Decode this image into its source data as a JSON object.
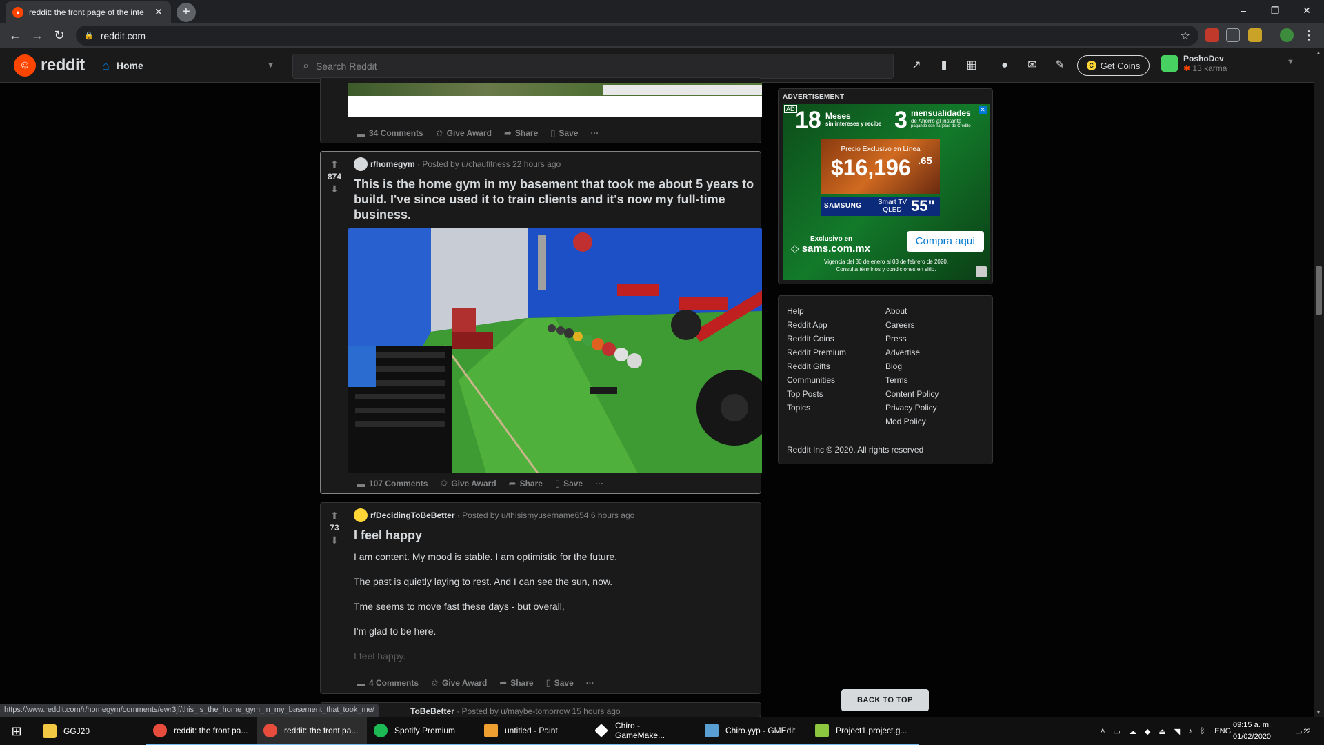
{
  "browser": {
    "tab_title": "reddit: the front page of the inte",
    "new_tab": "+",
    "url": "reddit.com",
    "controls": {
      "minimize": "–",
      "maximize": "❐",
      "close": "✕"
    }
  },
  "header": {
    "logo_text": "reddit",
    "home_label": "Home",
    "search_placeholder": "Search Reddit",
    "get_coins": "Get Coins",
    "username": "PoshoDev",
    "karma": "13 karma"
  },
  "posts": [
    {
      "comments": "34 Comments",
      "give_award": "Give Award",
      "share": "Share",
      "save": "Save",
      "more": "···"
    },
    {
      "votes": "874",
      "subreddit": "r/homegym",
      "posted_by": "· Posted by u/chaufitness 22 hours ago",
      "title": "This is the home gym in my basement that took me about 5 years to build. I've since used it to train clients and it's now my full-time business.",
      "comments": "107 Comments",
      "give_award": "Give Award",
      "share": "Share",
      "save": "Save",
      "more": "···"
    },
    {
      "votes": "73",
      "subreddit": "r/DecidingToBeBetter",
      "posted_by": "· Posted by u/thisismyusername654 6 hours ago",
      "title": "I feel happy",
      "paragraphs": [
        "I am content. My mood is stable. I am optimistic for the future.",
        "The past is quietly laying to rest. And I can see the sun, now.",
        "Tme seems to move fast these days - but overall,",
        "I'm glad to be here.",
        "I feel happy."
      ],
      "comments": "4 Comments",
      "give_award": "Give Award",
      "share": "Share",
      "save": "Save",
      "more": "···"
    },
    {
      "subreddit": "ToBeBetter",
      "posted_by": "· Posted by u/maybe-tomorrow 15 hours ago"
    }
  ],
  "sidebar": {
    "ad_label": "ADVERTISEMENT",
    "ad": {
      "tag": "AD",
      "months": "18",
      "meses": "Meses",
      "sin_intereses": "sin intereses y recibe",
      "three": "3",
      "mensualidades": "mensualidades",
      "de_ahorro": "de Ahorro al instante",
      "pagando": "pagando con Tarjetas de Crédito",
      "precio_label": "Precio Exclusivo en Línea",
      "price": "$16,196",
      "cents": ".65",
      "brand": "SAMSUNG",
      "product": "Smart TV QLED",
      "size": "55\"",
      "exclusivo": "Exclusivo en",
      "site": "sams.com.mx",
      "cta": "Compra aquí",
      "vigencia": "Vigencia del 30 de enero al 03 de febrero de 2020.",
      "consulta": "Consulta términos y condiciones en sitio."
    },
    "footer_col1": [
      "Help",
      "Reddit App",
      "Reddit Coins",
      "Reddit Premium",
      "Reddit Gifts",
      "Communities",
      "Top Posts",
      "Topics"
    ],
    "footer_col2": [
      "About",
      "Careers",
      "Press",
      "Advertise",
      "Blog",
      "Terms",
      "Content Policy",
      "Privacy Policy",
      "Mod Policy"
    ],
    "copyright": "Reddit Inc © 2020. All rights reserved",
    "back_to_top": "BACK TO TOP"
  },
  "status_url": "https://www.reddit.com/r/homegym/comments/ewr3jf/this_is_the_home_gym_in_my_basement_that_took_me/",
  "taskbar": {
    "items": [
      {
        "label": "GGJ20",
        "color": "#f2c744"
      },
      {
        "label": "reddit: the front pa...",
        "color": "#e74c3c"
      },
      {
        "label": "reddit: the front pa...",
        "color": "#e74c3c"
      },
      {
        "label": "Spotify Premium",
        "color": "#1db954"
      },
      {
        "label": "untitled - Paint",
        "color": "#f0a030"
      },
      {
        "label": "Chiro - GameMake...",
        "color": "#ffffff"
      },
      {
        "label": "Chiro.yyp - GMEdit",
        "color": "#5a9fd4"
      },
      {
        "label": "Project1.project.g...",
        "color": "#8dc63f"
      }
    ],
    "lang": "ENG",
    "time": "09:15 a. m.",
    "date": "01/02/2020",
    "notif": "22"
  }
}
